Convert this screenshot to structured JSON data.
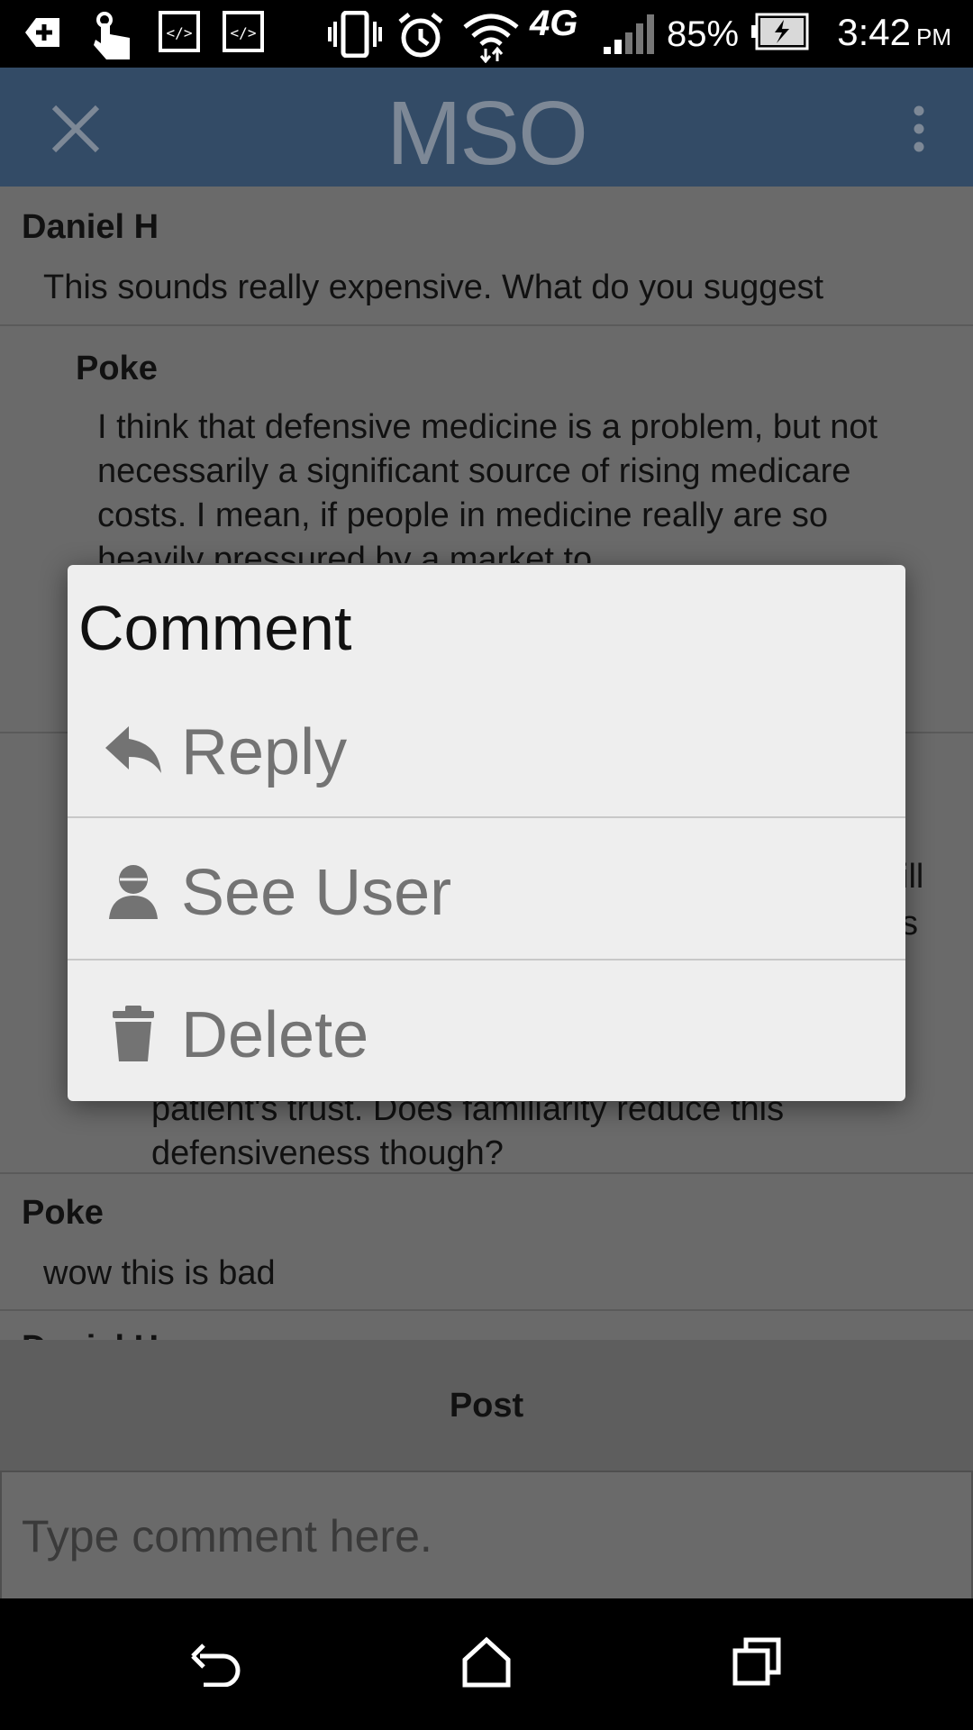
{
  "status_bar": {
    "battery_percent": "85%",
    "time": "3:42",
    "ampm": "PM",
    "network": "4G"
  },
  "app_bar": {
    "title": "MSO",
    "close_icon": "close-icon",
    "menu_icon": "more-vertical-icon"
  },
  "comments": [
    {
      "author": "Daniel H",
      "text": "This sounds really expensive. What do you suggest"
    },
    {
      "author": "Poke",
      "text": "I think that defensive medicine is a problem, but not necessarily a significant source of rising medicare costs. I mean, if people in medicine really are so heavily pressured by a market to"
    },
    {
      "partial_right": [
        "ill",
        "s"
      ]
    },
    {
      "text": "patient's trust. Does familiarity reduce this defensiveness though?"
    },
    {
      "author": "Poke",
      "text": "wow this is bad"
    },
    {
      "author": "Daniel H"
    }
  ],
  "dialog": {
    "title": "Comment",
    "items": [
      {
        "label": "Reply",
        "icon": "reply-icon"
      },
      {
        "label": "See User",
        "icon": "user-icon"
      },
      {
        "label": "Delete",
        "icon": "trash-icon"
      }
    ]
  },
  "post_bar": {
    "post_label": "Post",
    "input_placeholder": "Type comment here."
  },
  "colors": {
    "app_bar": "#334b66",
    "dialog_bg": "#eeeeee",
    "scrim_bg": "#6a6a6a"
  }
}
